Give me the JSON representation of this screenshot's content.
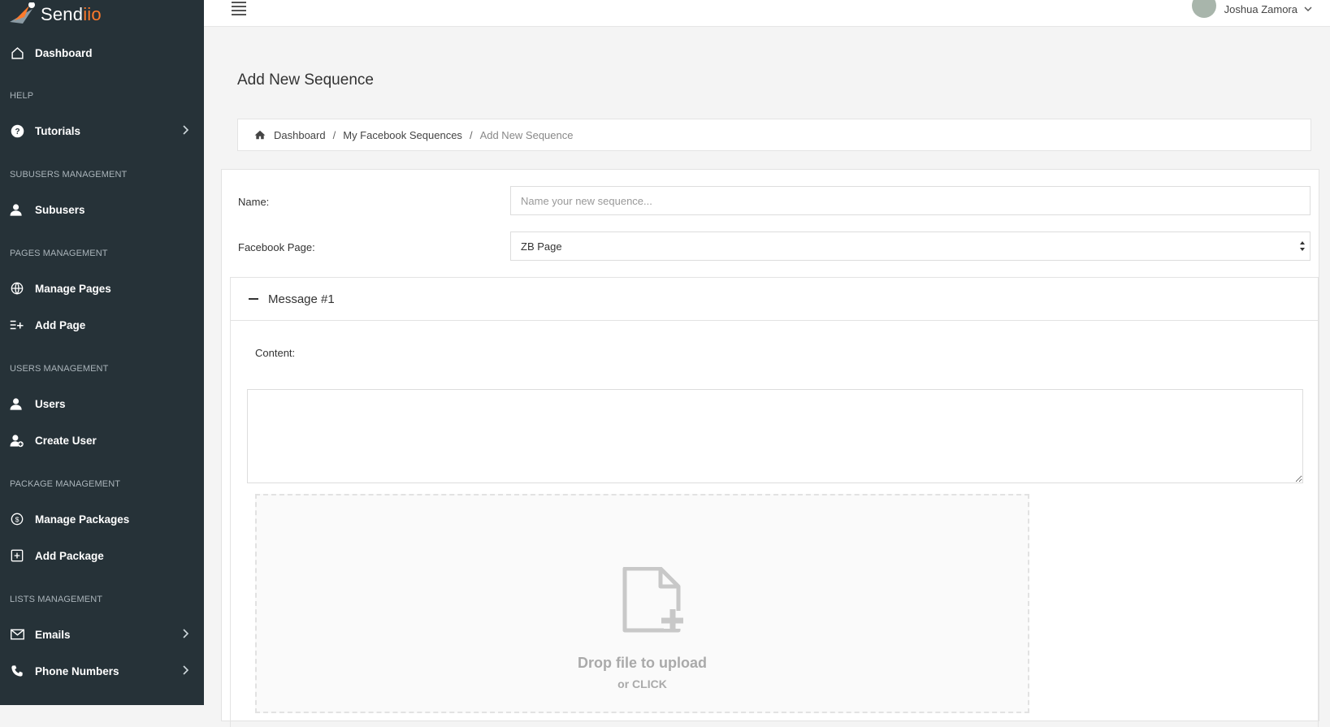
{
  "app": {
    "logo_text": "Send",
    "logo_accent": "iio",
    "brand_color": "#ff7a2b",
    "sidebar_color": "#263238"
  },
  "sidebar": {
    "dashboard": {
      "label": "Dashboard",
      "icon": "home-icon"
    },
    "sections": {
      "help": "HELP",
      "subusers": "SUBUSERS MANAGEMENT",
      "pages": "PAGES MANAGEMENT",
      "users": "USERS MANAGEMENT",
      "package": "PACKAGE MANAGEMENT",
      "lists": "LISTS MANAGEMENT"
    },
    "items": {
      "tutorials": {
        "label": "Tutorials",
        "icon": "question-circle-icon"
      },
      "subusers": {
        "label": "Subusers",
        "icon": "user-icon"
      },
      "manage_pages": {
        "label": "Manage Pages",
        "icon": "globe-icon"
      },
      "add_page": {
        "label": "Add Page",
        "icon": "list-plus-icon"
      },
      "users": {
        "label": "Users",
        "icon": "user-icon"
      },
      "create_user": {
        "label": "Create User",
        "icon": "user-plus-icon"
      },
      "manage_packages": {
        "label": "Manage Packages",
        "icon": "dollar-circle-icon"
      },
      "add_package": {
        "label": "Add Package",
        "icon": "plus-square-icon"
      },
      "emails": {
        "label": "Emails",
        "icon": "envelope-icon"
      },
      "phone_numbers": {
        "label": "Phone Numbers",
        "icon": "phone-icon"
      }
    }
  },
  "header": {
    "user_name": "Joshua Zamora"
  },
  "page": {
    "title": "Add New Sequence"
  },
  "breadcrumb": {
    "items": [
      "Dashboard",
      "My Facebook Sequences",
      "Add New Sequence"
    ],
    "separator": "/"
  },
  "form": {
    "name_label": "Name:",
    "name_placeholder": "Name your new sequence...",
    "name_value": "",
    "page_label": "Facebook Page:",
    "page_selected": "ZB Page"
  },
  "message": {
    "title": "Message #1",
    "content_label": "Content:",
    "content_value": "",
    "dropzone_title": "Drop file to upload",
    "dropzone_sub": "or CLICK"
  }
}
